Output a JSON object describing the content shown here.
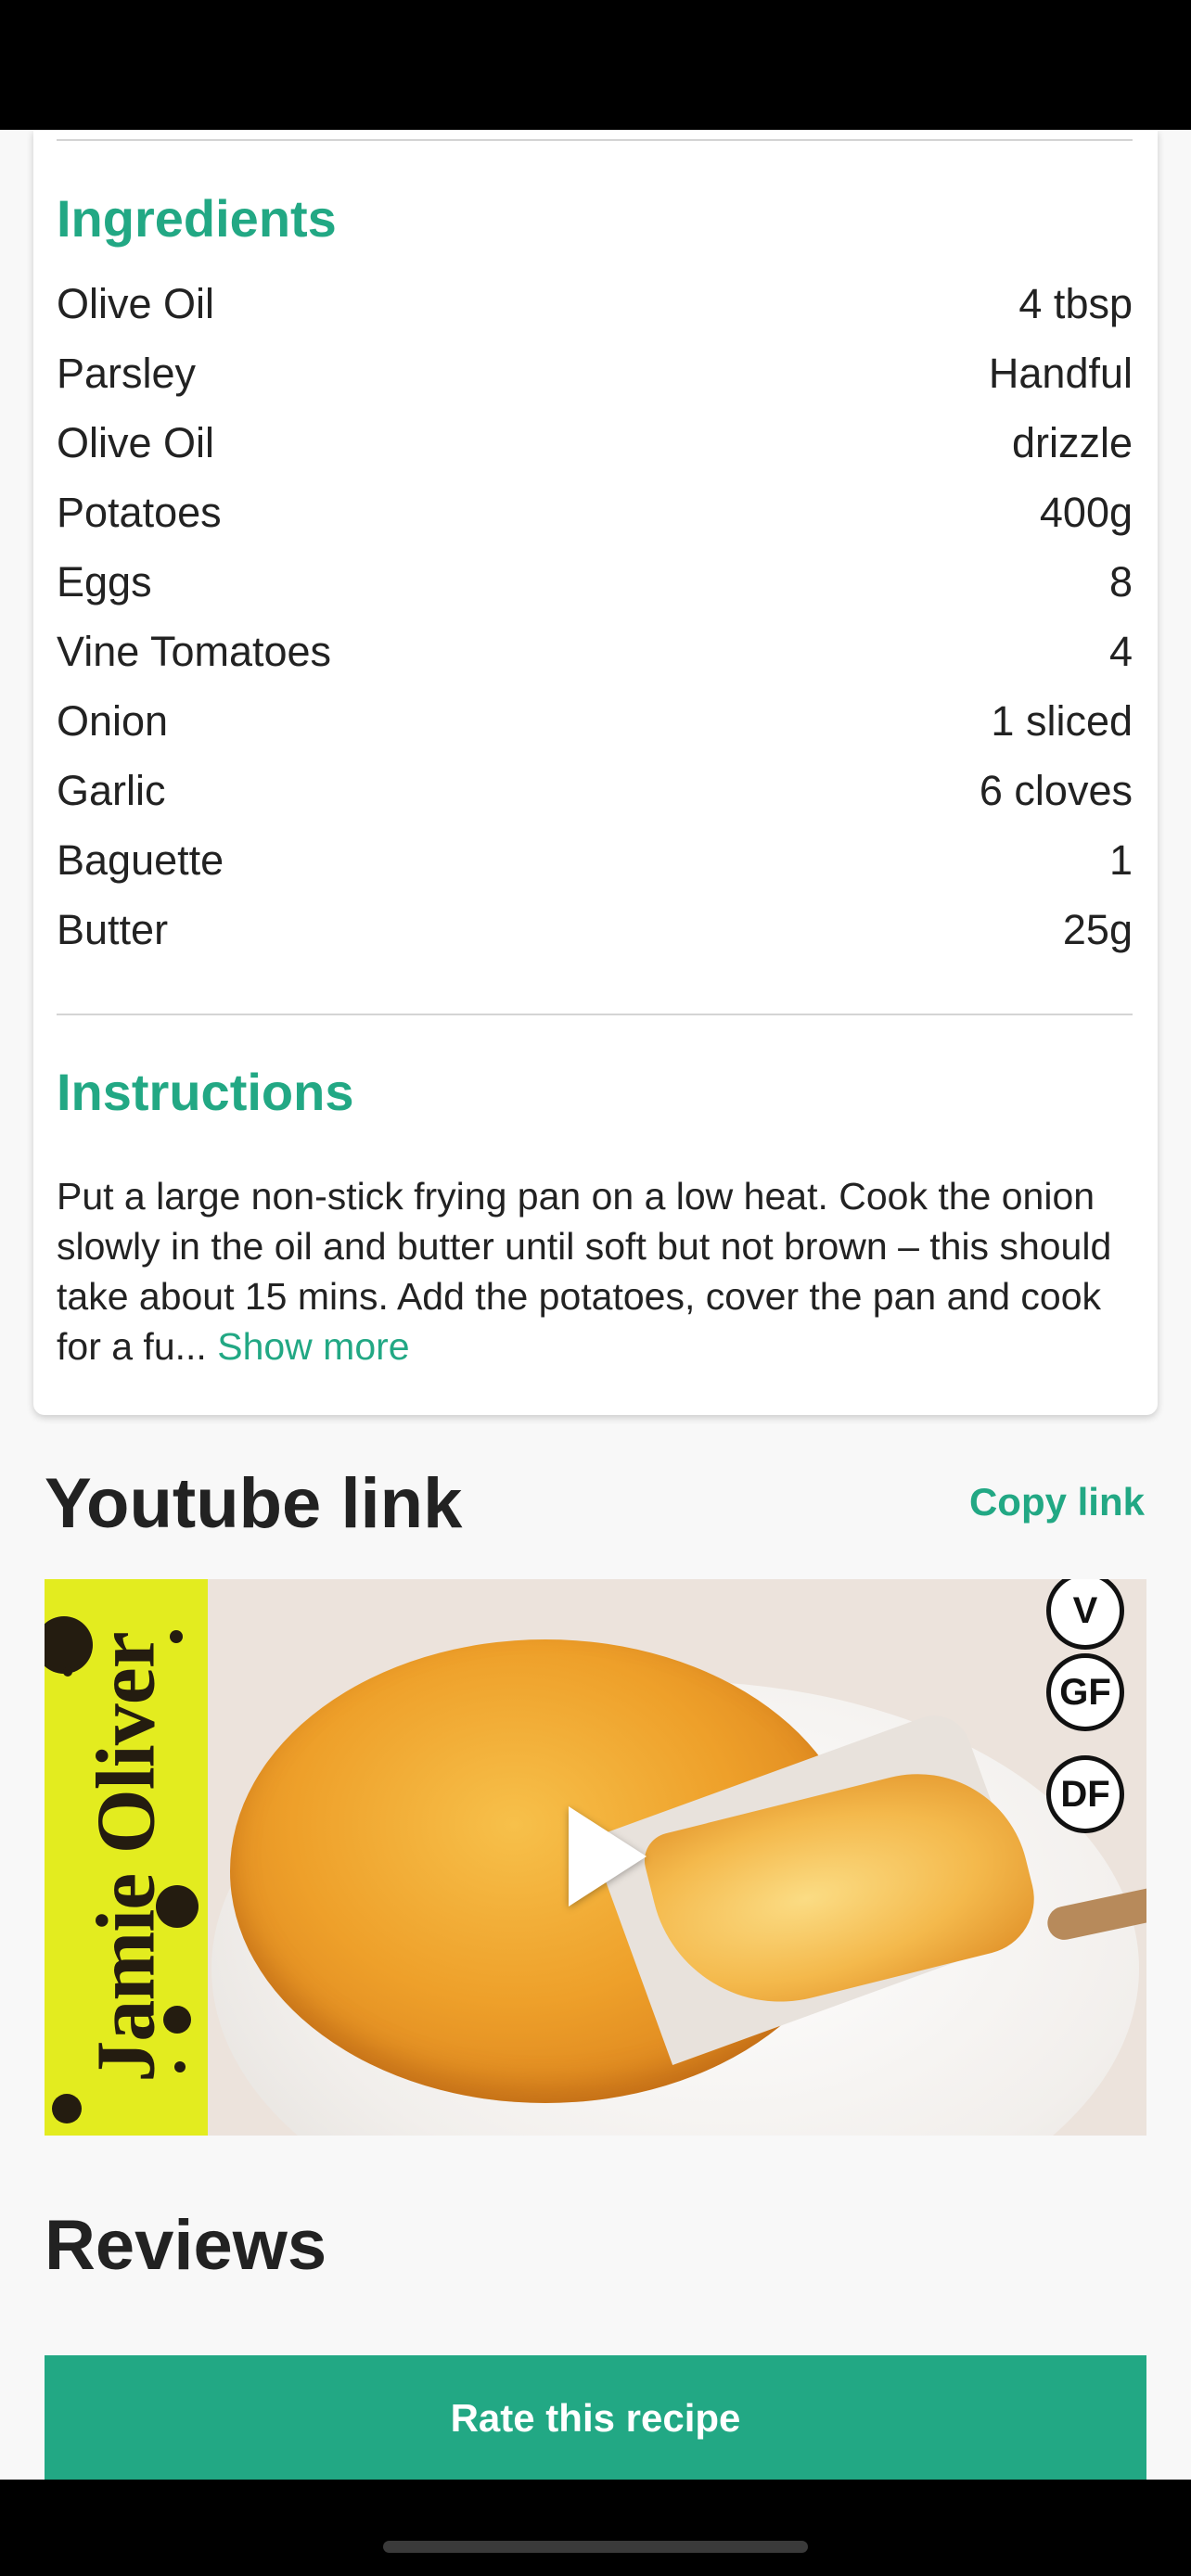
{
  "ingredients": {
    "heading": "Ingredients",
    "items": [
      {
        "name": "Olive Oil",
        "quantity": "4 tbsp"
      },
      {
        "name": "Parsley",
        "quantity": "Handful"
      },
      {
        "name": "Olive Oil",
        "quantity": "drizzle"
      },
      {
        "name": "Potatoes",
        "quantity": "400g"
      },
      {
        "name": "Eggs",
        "quantity": "8"
      },
      {
        "name": "Vine Tomatoes",
        "quantity": "4"
      },
      {
        "name": "Onion",
        "quantity": "1 sliced"
      },
      {
        "name": "Garlic",
        "quantity": "6 cloves"
      },
      {
        "name": "Baguette",
        "quantity": "1"
      },
      {
        "name": "Butter",
        "quantity": "25g"
      }
    ]
  },
  "instructions": {
    "heading": "Instructions",
    "text": "Put a large non-stick frying pan on a low heat. Cook the onion slowly in the oil and butter until soft but not brown – this should take about 15 mins. Add the potatoes, cover the pan and cook for a fu...",
    "show_more_label": "Show more"
  },
  "youtube": {
    "title": "Youtube link",
    "copy_link_label": "Copy link",
    "thumbnail": {
      "brand_text": "Jamie Oliver",
      "badges": [
        "V",
        "GF",
        "DF"
      ],
      "play_icon": "play-icon"
    }
  },
  "reviews": {
    "title": "Reviews",
    "rate_button_label": "Rate this recipe"
  },
  "colors": {
    "accent": "#22a884",
    "text": "#222222",
    "background": "#f8f8f8"
  }
}
